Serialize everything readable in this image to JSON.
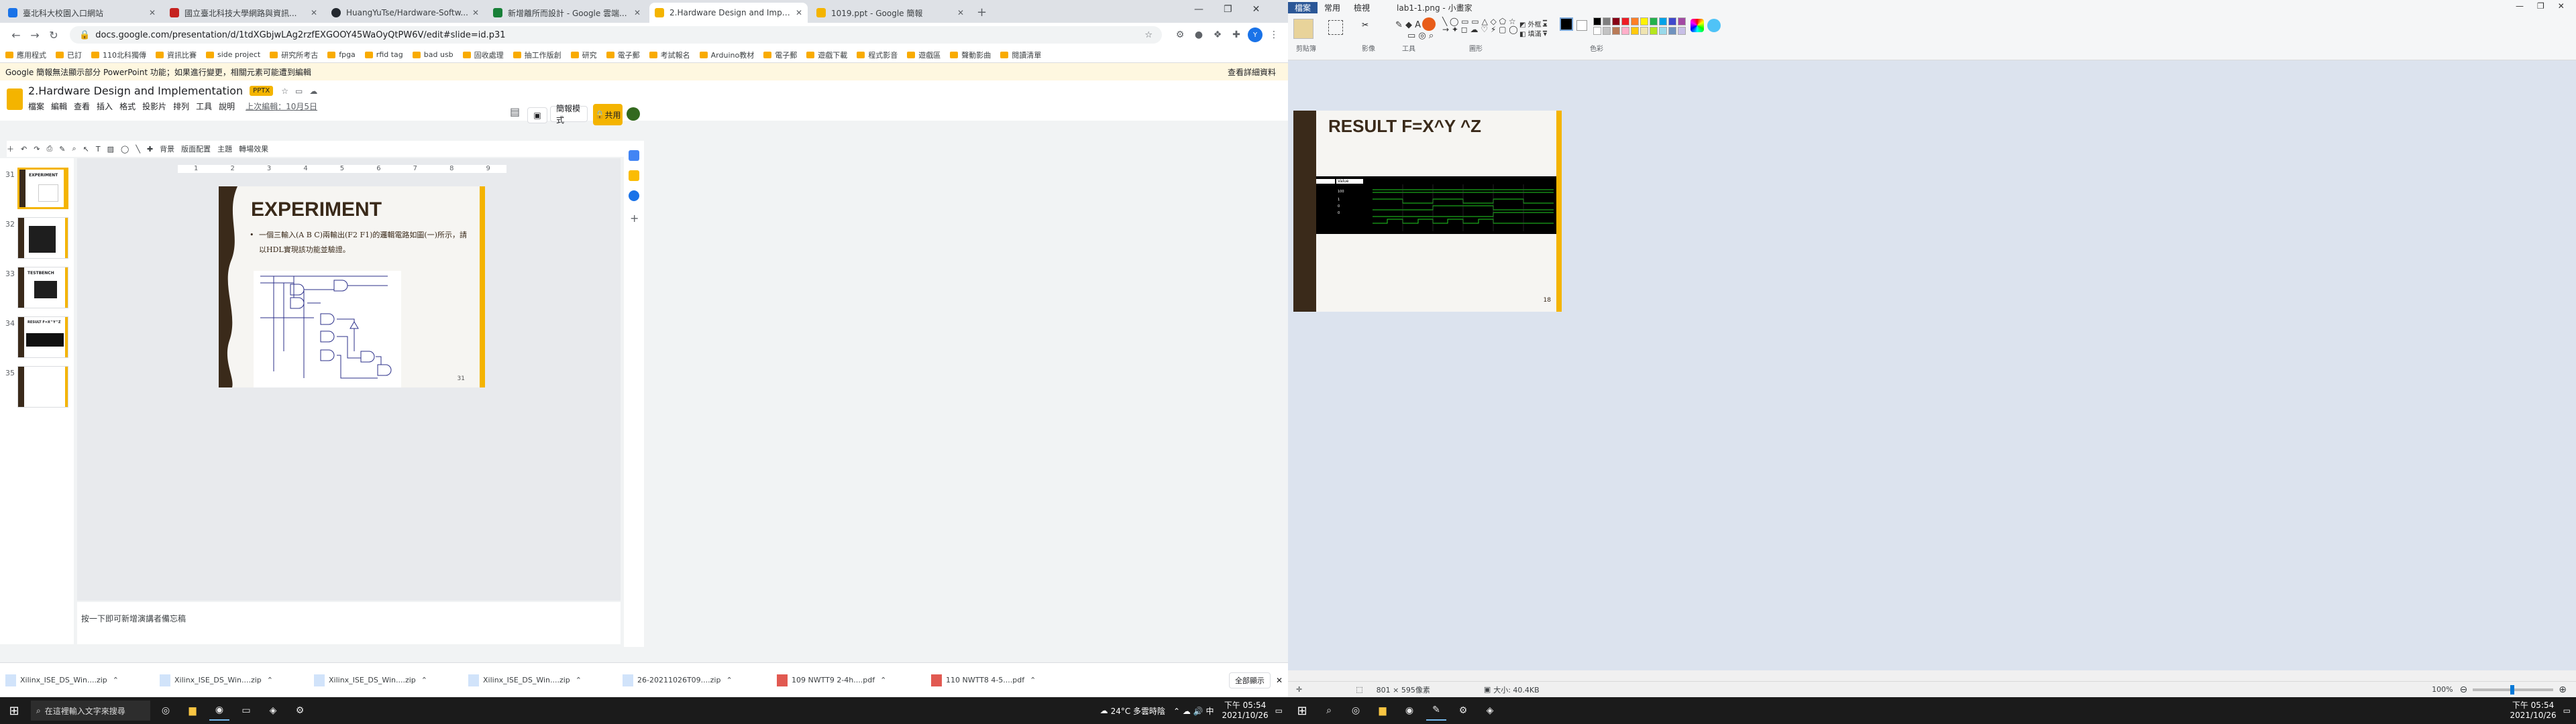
{
  "browser": {
    "tabs": [
      {
        "title": "臺北科大校園入口網站",
        "color": "#1a73e8"
      },
      {
        "title": "國立臺北科技大學網路與資訊...",
        "color": "#c5221f"
      },
      {
        "title": "HuangYuTse/Hardware-Softw...",
        "color": "#24292f"
      },
      {
        "title": "新增離所而設計 - Google 雲端...",
        "color": "#188038"
      },
      {
        "title": "2.Hardware Design and Implem...",
        "color": "#f4b400"
      },
      {
        "title": "1019.ppt - Google 簡報",
        "color": "#f4b400"
      }
    ],
    "url": "docs.google.com/presentation/d/1tdXGbjwLAg2rzfEXGOOY45WaOyQtPW6V/edit#slide=id.p31",
    "bookmarks": [
      "應用程式",
      "已訂",
      "110北科獨傳",
      "資訊比賽",
      "side project",
      "研究所考古",
      "fpga",
      "rfid tag",
      "bad usb",
      "固收處理",
      "抽工作版創",
      "研究",
      "電子郵",
      "考試報名",
      "Arduino教材",
      "電子郵",
      "遊戲下載",
      "程式影音",
      "遊戲區",
      "聲動影曲",
      "閱讀清單"
    ]
  },
  "notice": {
    "text": "Google 簡報無法顯示部分 PowerPoint 功能；如果進行變更，相關元素可能遭到編輯",
    "link": "查看詳細資料"
  },
  "slides": {
    "doc_title": "2.Hardware Design and Implementation",
    "badge": "PPTX",
    "menu": [
      "檔案",
      "編輯",
      "查看",
      "插入",
      "格式",
      "投影片",
      "排列",
      "工具",
      "說明"
    ],
    "last_edit": "上次編輯：10月5日",
    "present_btn": "簡報模式",
    "share_btn": "共用",
    "toolbar": [
      "背景",
      "版面配置",
      "主題",
      "轉場效果"
    ],
    "ruler_marks": [
      "1",
      "2",
      "3",
      "4",
      "5",
      "6",
      "7",
      "8",
      "9"
    ],
    "thumbnails": [
      {
        "num": "31",
        "title": "EXPERIMENT"
      },
      {
        "num": "32",
        "title": ""
      },
      {
        "num": "33",
        "title": "TESTBENCH"
      },
      {
        "num": "34",
        "title": "RESULT F=X^Y^Z"
      },
      {
        "num": "35",
        "title": ""
      }
    ],
    "current_slide": {
      "title": "EXPERIMENT",
      "bullet": "一個三輸入(A B C)兩輸出(F2 F1)的邏輯電路如圖(一)所示，請以HDL實現該功能並驗證。",
      "page": "31"
    },
    "notes_placeholder": "按一下即可新增演講者備忘稿"
  },
  "downloads": [
    "Xilinx_ISE_DS_Win....zip",
    "Xilinx_ISE_DS_Win....zip",
    "Xilinx_ISE_DS_Win....zip",
    "Xilinx_ISE_DS_Win....zip",
    "26-20211026T09....zip",
    "109 NWTT9 2-4h....pdf",
    "110 NWTT8 4-5....pdf"
  ],
  "downloads_all": "全部顯示",
  "taskbar_left": {
    "search": "在這裡輸入文字來搜尋",
    "weather": "24°C 多雲時陰",
    "time": "下午 05:54",
    "date": "2021/10/26"
  },
  "paint": {
    "window_title": "lab1-1.png - 小畫家",
    "tabs": [
      "檔案",
      "常用",
      "檢視"
    ],
    "groups": [
      "剪貼簿",
      "影像",
      "工具",
      "圖形",
      "色彩"
    ],
    "slide_title": "RESULT F=X^Y ^Z",
    "page": "18",
    "wave_headers": [
      "Name",
      "Value"
    ],
    "wave_values": [
      "100",
      "1",
      "0",
      "0"
    ],
    "status": {
      "size": "801 × 595像素",
      "file": "大小: 40.4KB",
      "zoom": "100%"
    },
    "palette": [
      "#000000",
      "#7f7f7f",
      "#880015",
      "#ed1c24",
      "#ff7f27",
      "#fff200",
      "#22b14c",
      "#00a2e8",
      "#3f48cc",
      "#a349a4",
      "#ffffff",
      "#c3c3c3",
      "#b97a57",
      "#ffaec9",
      "#ffc90e",
      "#efe4b0",
      "#b5e61d",
      "#99d9ea",
      "#7092be",
      "#c8bfe7"
    ]
  },
  "taskbar_right": {
    "time": "下午 05:54",
    "date": "2021/10/26"
  }
}
